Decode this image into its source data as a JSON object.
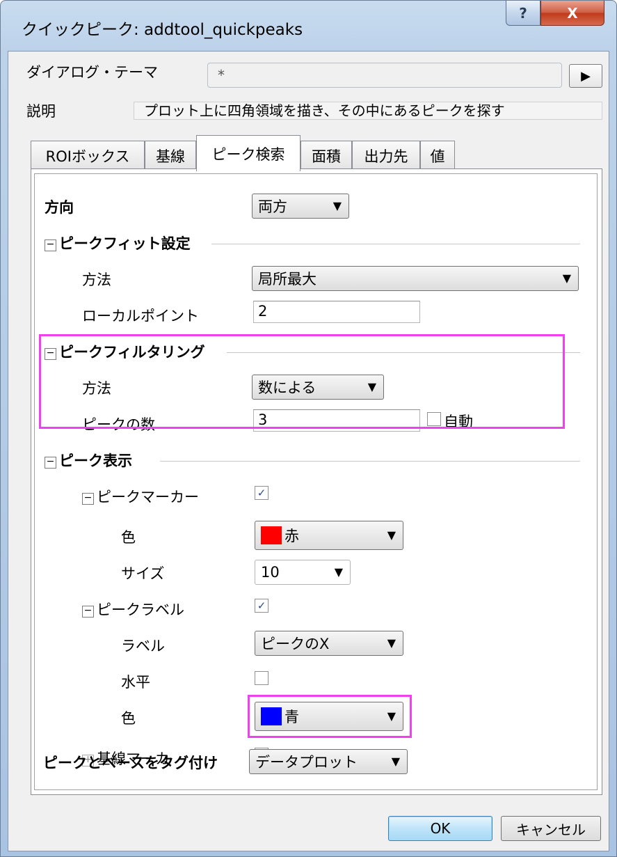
{
  "window": {
    "title": "クイックピーク: addtool_quickpeaks",
    "help_glyph": "?",
    "close_glyph": "X"
  },
  "header": {
    "theme_label": "ダイアログ・テーマ",
    "theme_value": "*",
    "theme_arrow": "▶",
    "desc_label": "説明",
    "desc_value": "プロット上に四角領域を描き、その中にあるピークを探す"
  },
  "tabs": [
    "ROIボックス",
    "基線",
    "ピーク検索",
    "面積",
    "出力先",
    "値"
  ],
  "active_tab_index": 2,
  "form": {
    "direction_label": "方向",
    "direction_value": "両方",
    "peak_fit_section": "ピークフィット設定",
    "fit_method_label": "方法",
    "fit_method_value": "局所最大",
    "local_points_label": "ローカルポイント",
    "local_points_value": "2",
    "filter_section": "ピークフィルタリング",
    "filter_method_label": "方法",
    "filter_method_value": "数による",
    "peak_count_label": "ピークの数",
    "peak_count_value": "3",
    "auto_label": "自動",
    "display_section": "ピーク表示",
    "marker_section": "ピークマーカー",
    "marker_color_label": "色",
    "marker_color_value": "赤",
    "marker_color_hex": "#ff0000",
    "marker_size_label": "サイズ",
    "marker_size_value": "10",
    "label_section": "ピークラベル",
    "label_label": "ラベル",
    "label_value": "ピークのX",
    "horizontal_label": "水平",
    "label_color_label": "色",
    "label_color_value": "青",
    "label_color_hex": "#0000ff",
    "baseline_marker_section": "基線マーカ",
    "tag_label": "ピークとベースをタグ付け",
    "tag_value": "データプロット"
  },
  "buttons": {
    "ok": "OK",
    "cancel": "キャンセル"
  },
  "colors": {
    "highlight": "#f040f0"
  }
}
